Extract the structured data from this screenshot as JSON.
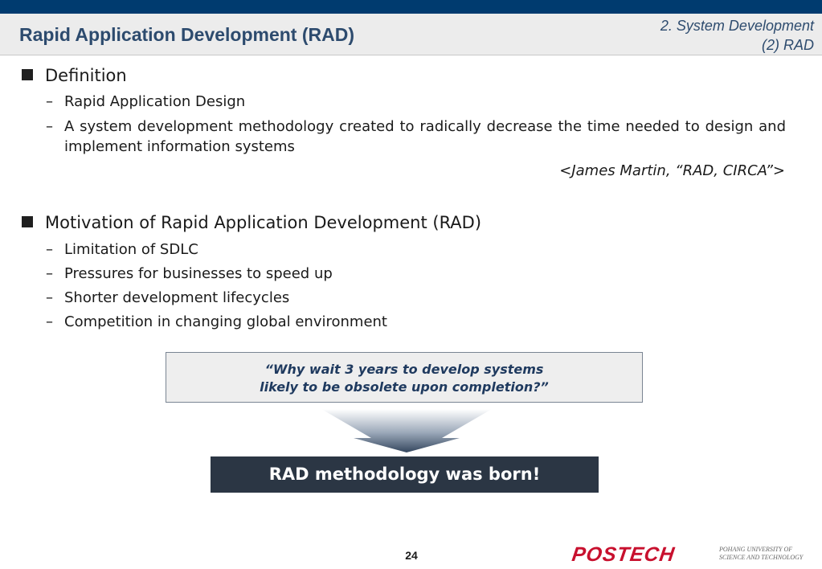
{
  "header": {
    "title": "Rapid Application Development (RAD)",
    "section_line1": "2. System Development",
    "section_line2": "(2) RAD"
  },
  "definition": {
    "heading": "Definition",
    "items": [
      "Rapid Application Design",
      "A system development methodology created to radically decrease the time needed to design and implement information systems"
    ],
    "citation": "<James Martin, “RAD, CIRCA”>"
  },
  "motivation": {
    "heading": "Motivation of Rapid Application Development (RAD)",
    "items": [
      "Limitation of SDLC",
      "Pressures for businesses to speed up",
      "Shorter development lifecycles",
      "Competition in changing global environment"
    ]
  },
  "quote": {
    "line1": "“Why wait 3 years to develop systems",
    "line2": "likely to be obsolete upon completion?”"
  },
  "result": "RAD methodology was born!",
  "footer": {
    "page_number": "24",
    "logo": "POSTECH",
    "logo_sub1": "POHANG UNIVERSITY OF",
    "logo_sub2": "SCIENCE AND TECHNOLOGY"
  },
  "bullet_dash": "–",
  "colors": {
    "top_bar": "#003b6f",
    "title_text": "#2d4b6e",
    "result_box": "#2b3644",
    "logo_red": "#c8102e"
  },
  "icons": {
    "heading_bullet": "square-bullet-icon",
    "funnel": "funnel-arrow-icon"
  }
}
